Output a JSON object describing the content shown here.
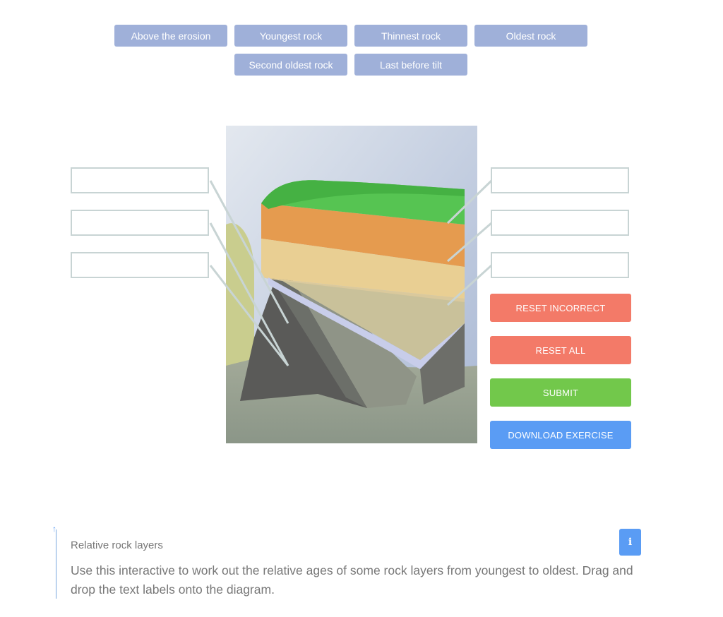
{
  "labels": [
    "Above the erosion",
    "Youngest rock",
    "Thinnest rock",
    "Oldest rock",
    "Second oldest rock",
    "Last before tilt"
  ],
  "buttons": {
    "reset_incorrect": "RESET INCORRECT",
    "reset_all": "RESET ALL",
    "submit": "SUBMIT",
    "download": "DOWNLOAD EXERCISE"
  },
  "info": {
    "title": "Relative rock layers",
    "description": "Use this interactive to work out the relative ages of some rock layers from youngest to oldest. Drag and drop the text labels onto the diagram.",
    "icon": "info-icon"
  },
  "colors": {
    "chip": "#9fb0d9",
    "reset": "#f37a68",
    "submit": "#72c84b",
    "download": "#5a9cf4"
  }
}
